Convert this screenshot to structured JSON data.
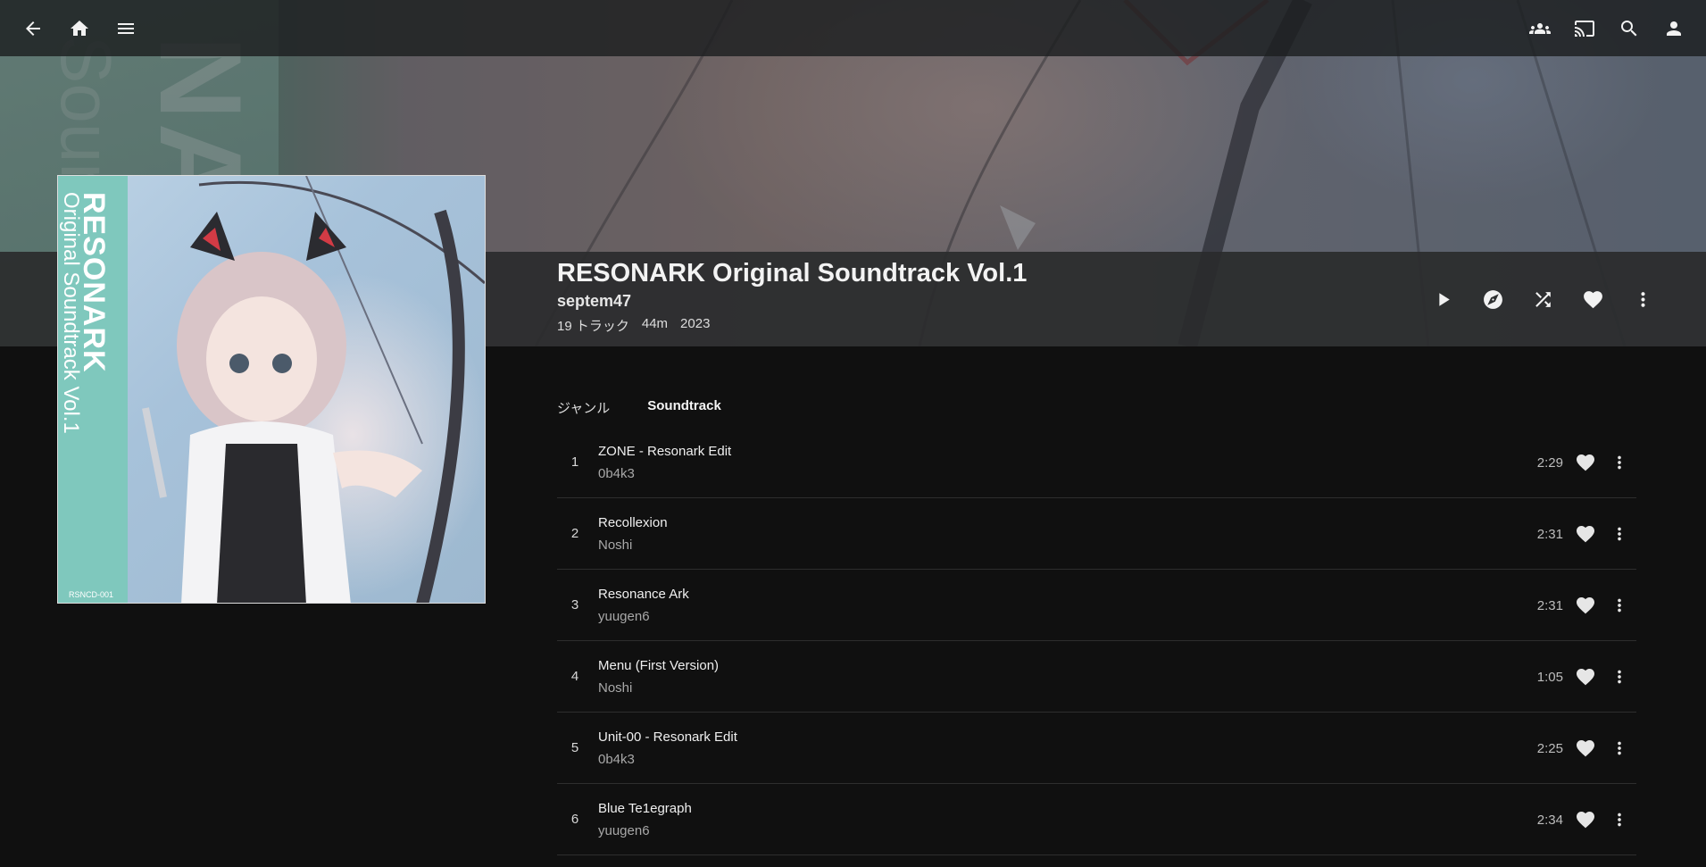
{
  "nav": {
    "back_icon": "arrow-left-icon",
    "home_icon": "home-icon",
    "menu_icon": "hamburger-menu-icon",
    "right_icons": [
      "group-icon",
      "cast-icon",
      "search-icon",
      "account-icon"
    ]
  },
  "banner": {
    "letters_large": "NA",
    "letters_small": "Soun"
  },
  "album": {
    "title": "RESONARK Original Soundtrack Vol.1",
    "artist": "septem47",
    "track_count": "19 トラック",
    "duration": "44m",
    "year": "2023",
    "cover": {
      "title_text": "RESONARK",
      "subtitle_text": "Original Soundtrack Vol.1",
      "catalog_code": "RSNCD-001"
    }
  },
  "header_actions": [
    "play-icon",
    "compass-icon",
    "shuffle-icon",
    "heart-icon",
    "more-vert-icon"
  ],
  "genre": {
    "label": "ジャンル",
    "value": "Soundtrack"
  },
  "tracks": [
    {
      "num": "1",
      "title": "ZONE - Resonark Edit",
      "artist": "0b4k3",
      "duration": "2:29"
    },
    {
      "num": "2",
      "title": "Recollexion",
      "artist": "Noshi",
      "duration": "2:31"
    },
    {
      "num": "3",
      "title": "Resonance Ark",
      "artist": "yuugen6",
      "duration": "2:31"
    },
    {
      "num": "4",
      "title": "Menu (First Version)",
      "artist": "Noshi",
      "duration": "1:05"
    },
    {
      "num": "5",
      "title": "Unit-00 - Resonark Edit",
      "artist": "0b4k3",
      "duration": "2:25"
    },
    {
      "num": "6",
      "title": "Blue Te1egraph",
      "artist": "yuugen6",
      "duration": "2:34"
    }
  ],
  "colors": {
    "background": "#101010",
    "header_strip": "#2a2b2d",
    "cover_side": "#7fc8bd"
  }
}
